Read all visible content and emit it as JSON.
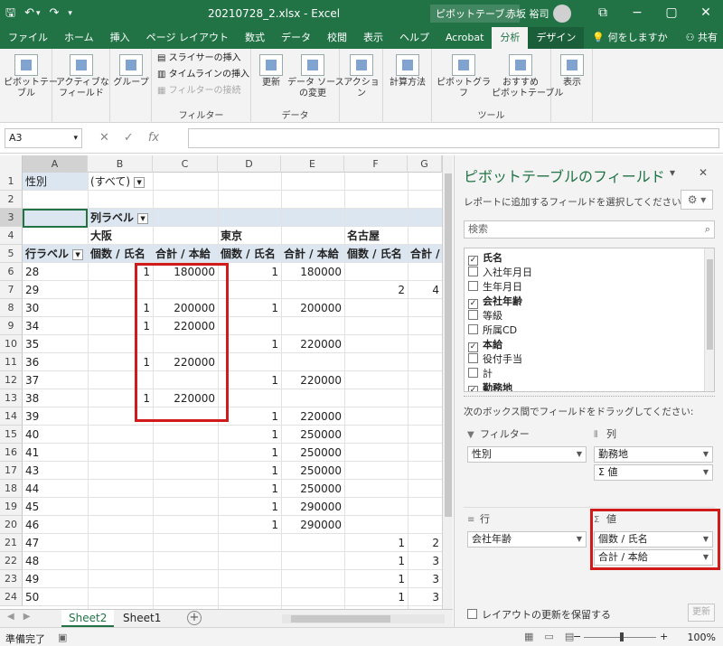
{
  "window": {
    "title": "20210728_2.xlsx  -  Excel",
    "context_tool": "ピボットテーブ...",
    "user": "赤坂 裕司",
    "min_btn": "−",
    "max_btn": "▢",
    "close_btn": "✕",
    "opts_btn": "⧉"
  },
  "qat": {
    "save": "🖫",
    "undo": "↶",
    "undo_dd": "▾",
    "redo": "↷",
    "more": "▾"
  },
  "tabs": [
    "ファイル",
    "ホーム",
    "挿入",
    "ページ レイアウト",
    "数式",
    "データ",
    "校閲",
    "表示",
    "ヘルプ",
    "Acrobat",
    "分析",
    "デザイン"
  ],
  "tell_me": "何をしますか",
  "share": "共有",
  "ribbon": {
    "pivot_table": "ピボットテー\nブル",
    "active_field": "アクティブな\nフィールド",
    "group": "グループ",
    "slicer": "スライサーの挿入",
    "timeline": "タイムラインの挿入",
    "filter_conn": "フィルターの接続",
    "filter_group": "フィルター",
    "refresh": "更新",
    "change_source": "データ ソース\nの変更",
    "data_group": "データ",
    "actions": "アクション",
    "calc": "計算方法",
    "pivot_chart": "ピボットグラフ",
    "recommended": "おすすめ\nピボットテーブル",
    "tools_group": "ツール",
    "show": "表示"
  },
  "formula_bar": {
    "name_box": "A3",
    "cancel": "✕",
    "enter": "✓",
    "fx": "fx",
    "value": ""
  },
  "columns": [
    "A",
    "B",
    "C",
    "D",
    "E",
    "F",
    "G"
  ],
  "rows": [
    {
      "n": "1",
      "a": "性別",
      "b": "(すべて)"
    },
    {
      "n": "2"
    },
    {
      "n": "3",
      "b": "列ラベル"
    },
    {
      "n": "4",
      "b": "大阪",
      "d": "東京",
      "f": "名古屋"
    },
    {
      "n": "5",
      "a": "行ラベル",
      "b": "個数 / 氏名",
      "c": "合計 / 本給",
      "d": "個数 / 氏名",
      "e": "合計 / 本給",
      "f": "個数 / 氏名",
      "g": "合計 / 本"
    },
    {
      "n": "6",
      "a": "28",
      "b": "1",
      "c": "180000",
      "d": "1",
      "e": "180000"
    },
    {
      "n": "7",
      "a": "29",
      "f": "2",
      "g": "4"
    },
    {
      "n": "8",
      "a": "30",
      "b": "1",
      "c": "200000",
      "d": "1",
      "e": "200000"
    },
    {
      "n": "9",
      "a": "34",
      "b": "1",
      "c": "220000"
    },
    {
      "n": "10",
      "a": "35",
      "d": "1",
      "e": "220000"
    },
    {
      "n": "11",
      "a": "36",
      "b": "1",
      "c": "220000"
    },
    {
      "n": "12",
      "a": "37",
      "d": "1",
      "e": "220000"
    },
    {
      "n": "13",
      "a": "38",
      "b": "1",
      "c": "220000"
    },
    {
      "n": "14",
      "a": "39",
      "d": "1",
      "e": "220000"
    },
    {
      "n": "15",
      "a": "40",
      "d": "1",
      "e": "250000"
    },
    {
      "n": "16",
      "a": "41",
      "d": "1",
      "e": "250000"
    },
    {
      "n": "17",
      "a": "43",
      "d": "1",
      "e": "250000"
    },
    {
      "n": "18",
      "a": "44",
      "d": "1",
      "e": "250000"
    },
    {
      "n": "19",
      "a": "45",
      "d": "1",
      "e": "290000"
    },
    {
      "n": "20",
      "a": "46",
      "d": "1",
      "e": "290000"
    },
    {
      "n": "21",
      "a": "47",
      "f": "1",
      "g": "2"
    },
    {
      "n": "22",
      "a": "48",
      "f": "1",
      "g": "3"
    },
    {
      "n": "23",
      "a": "49",
      "f": "1",
      "g": "3"
    },
    {
      "n": "24",
      "a": "50",
      "f": "1",
      "g": "3"
    }
  ],
  "sheets": [
    "Sheet2",
    "Sheet1"
  ],
  "add_sheet": "+",
  "status": {
    "ready": "準備完了",
    "zoom": "100%",
    "minus": "−",
    "plus": "+"
  },
  "pivot_panel": {
    "title": "ピボットテーブルのフィールド",
    "hint": "レポートに追加するフィールドを選択してください:",
    "gear": "⚙ ▾",
    "search_placeholder": "検索",
    "fields": [
      {
        "name": "氏名",
        "checked": true
      },
      {
        "name": "入社年月日",
        "checked": false
      },
      {
        "name": "生年月日",
        "checked": false
      },
      {
        "name": "会社年齢",
        "checked": true
      },
      {
        "name": "等級",
        "checked": false
      },
      {
        "name": "所属CD",
        "checked": false
      },
      {
        "name": "本給",
        "checked": true
      },
      {
        "name": "役付手当",
        "checked": false
      },
      {
        "name": "計",
        "checked": false
      },
      {
        "name": "勤務地",
        "checked": true
      }
    ],
    "drag_hint": "次のボックス間でフィールドをドラッグしてください:",
    "filter_label": "フィルター",
    "columns_label": "列",
    "rows_label": "行",
    "values_label": "値",
    "filter_items": [
      "性別"
    ],
    "column_items": [
      "勤務地",
      "Σ 値"
    ],
    "row_items": [
      "会社年齢"
    ],
    "value_items": [
      "個数 / 氏名",
      "合計 / 本給"
    ],
    "defer": "レイアウトの更新を保留する",
    "update": "更新"
  },
  "colors": {
    "excel_green": "#217346",
    "pivot_header": "#dce6f1",
    "highlight": "#d11a1a"
  }
}
